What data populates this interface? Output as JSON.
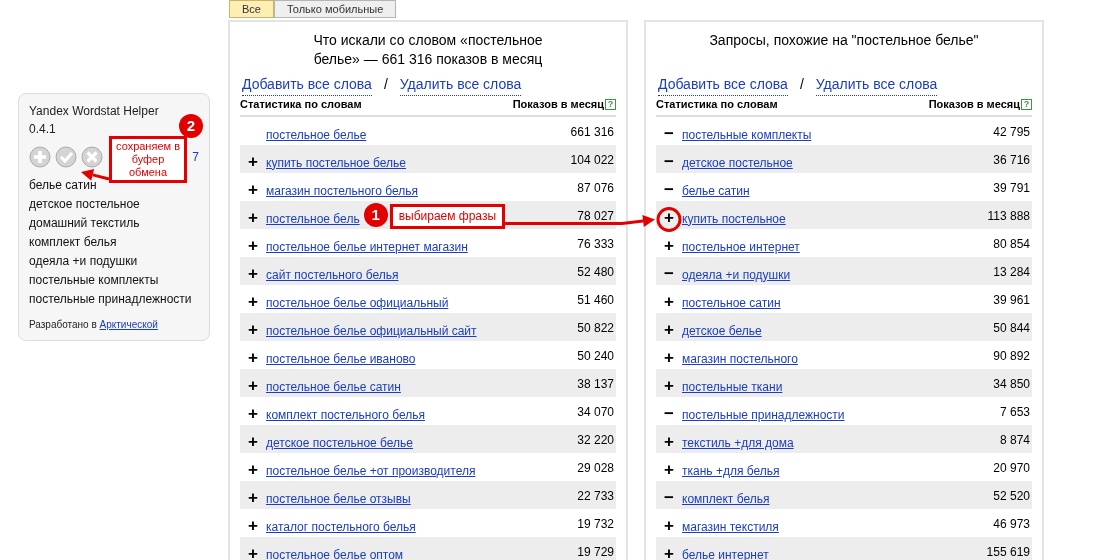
{
  "tabs": [
    {
      "label": "Все",
      "selected": true
    },
    {
      "label": "Только мобильные",
      "selected": false
    }
  ],
  "helper": {
    "title": "Yandex Wordstat Helper",
    "version": "0.4.1",
    "count": "7",
    "words": [
      "белье сатин",
      "детское постельное",
      "домашний текстиль",
      "комплект белья",
      "одеяла +и подушки",
      "постельные комплекты",
      "постельные принадлежности"
    ],
    "credit_text": "Разработано в",
    "credit_link": "Арктической"
  },
  "tables": [
    {
      "title": "Что искали со словом «постельное белье» — 661 316 показов в месяц",
      "add_all": "Добавить все слова",
      "separator": "/",
      "remove_all": "Удалить все слова",
      "col_phrase": "Статистика по словам",
      "col_count": "Показов в месяц",
      "help": "?",
      "rows": [
        {
          "phrase": "постельное белье",
          "count": "661 316"
        },
        {
          "sign": "+",
          "phrase": "купить постельное белье",
          "count": "104 022"
        },
        {
          "sign": "+",
          "phrase": "магазин постельного белья",
          "count": "87 076"
        },
        {
          "sign": "+",
          "phrase": "постельное бель",
          "count": "78 027"
        },
        {
          "sign": "+",
          "phrase": "постельное белье интернет магазин",
          "count": "76 333"
        },
        {
          "sign": "+",
          "phrase": "сайт постельного белья",
          "count": "52 480"
        },
        {
          "sign": "+",
          "phrase": "постельное белье официальный",
          "count": "51 460"
        },
        {
          "sign": "+",
          "phrase": "постельное белье официальный сайт",
          "count": "50 822"
        },
        {
          "sign": "+",
          "phrase": "постельное белье иваново",
          "count": "50 240"
        },
        {
          "sign": "+",
          "phrase": "постельное белье сатин",
          "count": "38 137"
        },
        {
          "sign": "+",
          "phrase": "комплект постельного белья",
          "count": "34 070"
        },
        {
          "sign": "+",
          "phrase": "детское постельное белье",
          "count": "32 220"
        },
        {
          "sign": "+",
          "phrase": "постельное белье +от производителя",
          "count": "29 028"
        },
        {
          "sign": "+",
          "phrase": "постельное белье отзывы",
          "count": "22 733"
        },
        {
          "sign": "+",
          "phrase": "каталог постельного белья",
          "count": "19 732"
        },
        {
          "sign": "+",
          "phrase": "постельное белье оптом",
          "count": "19 729"
        }
      ]
    },
    {
      "title": "Запросы, похожие на \"постельное белье\"",
      "add_all": "Добавить все слова",
      "separator": "/",
      "remove_all": "Удалить все слова",
      "col_phrase": "Статистика по словам",
      "col_count": "Показов в месяц",
      "help": "?",
      "rows": [
        {
          "sign": "−",
          "phrase": "постельные комплекты",
          "count": "42 795",
          "circled": false
        },
        {
          "sign": "−",
          "phrase": "детское постельное",
          "count": "36 716",
          "circled": false
        },
        {
          "sign": "−",
          "phrase": "белье сатин",
          "count": "39 791",
          "circled": false
        },
        {
          "sign": "+",
          "phrase": "купить постельное",
          "count": "113 888",
          "circled": true
        },
        {
          "sign": "+",
          "phrase": "постельное интернет",
          "count": "80 854",
          "circled": false
        },
        {
          "sign": "−",
          "phrase": "одеяла +и подушки",
          "count": "13 284",
          "circled": false
        },
        {
          "sign": "+",
          "phrase": "постельное сатин",
          "count": "39 961",
          "circled": false
        },
        {
          "sign": "+",
          "phrase": "детское белье",
          "count": "50 844",
          "circled": false
        },
        {
          "sign": "+",
          "phrase": "магазин постельного",
          "count": "90 892",
          "circled": false
        },
        {
          "sign": "+",
          "phrase": "постельные ткани",
          "count": "34 850",
          "circled": false
        },
        {
          "sign": "−",
          "phrase": "постельные принадлежности",
          "count": "7 653",
          "circled": false
        },
        {
          "sign": "+",
          "phrase": "текстиль +для дома",
          "count": "8 874",
          "circled": false
        },
        {
          "sign": "+",
          "phrase": "ткань +для белья",
          "count": "20 970",
          "circled": false
        },
        {
          "sign": "−",
          "phrase": "комплект белья",
          "count": "52 520",
          "circled": false
        },
        {
          "sign": "+",
          "phrase": "магазин текстиля",
          "count": "46 973",
          "circled": false
        },
        {
          "sign": "+",
          "phrase": "белье интернет",
          "count": "155 619",
          "circled": false
        }
      ]
    }
  ],
  "annotations": [
    {
      "number": "1",
      "text": "выбираем фразы"
    },
    {
      "number": "2",
      "text": "сохраняем в буфер обмена"
    }
  ]
}
